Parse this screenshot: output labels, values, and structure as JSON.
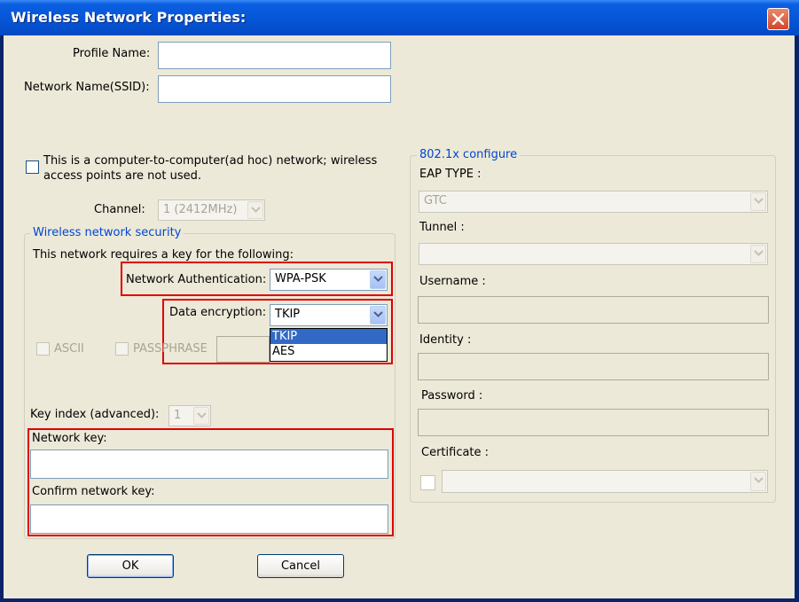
{
  "window": {
    "title": "Wireless Network Properties:"
  },
  "profile_name": {
    "label": "Profile Name:",
    "value": ""
  },
  "network_name": {
    "label": "Network Name(SSID):",
    "value": ""
  },
  "adhoc": {
    "line1": "This is a computer-to-computer(ad hoc) network; wireless",
    "line2": "access points are not used.",
    "checked": false
  },
  "channel": {
    "label": "Channel:",
    "value": "1  (2412MHz)"
  },
  "security": {
    "group_title": "Wireless network security",
    "requires_key_text": "This network requires a key for the following:",
    "auth_label": "Network Authentication:",
    "auth_value": "WPA-PSK",
    "enc_label": "Data encryption:",
    "enc_value": "TKIP",
    "enc_options": [
      "TKIP",
      "AES"
    ],
    "ascii_label": "ASCII",
    "passphrase_label": "PASSPHRASE",
    "key_index_label": "Key index (advanced):",
    "key_index_value": "1",
    "network_key_label": "Network key:",
    "network_key_value": "",
    "confirm_key_label": "Confirm network key:",
    "confirm_key_value": ""
  },
  "x8021": {
    "group_title": "802.1x configure",
    "eap_label": "EAP TYPE :",
    "eap_value": "GTC",
    "tunnel_label": "Tunnel :",
    "tunnel_value": "",
    "username_label": "Username :",
    "identity_label": "Identity :",
    "password_label": "Password :",
    "certificate_label": "Certificate :"
  },
  "buttons": {
    "ok": "OK",
    "cancel": "Cancel"
  },
  "colors": {
    "title_bar": "#0554d6",
    "dialog_bg": "#ece9d8",
    "highlight_red": "#e00000",
    "selection": "#316ac5",
    "group_title": "#0046d5"
  }
}
